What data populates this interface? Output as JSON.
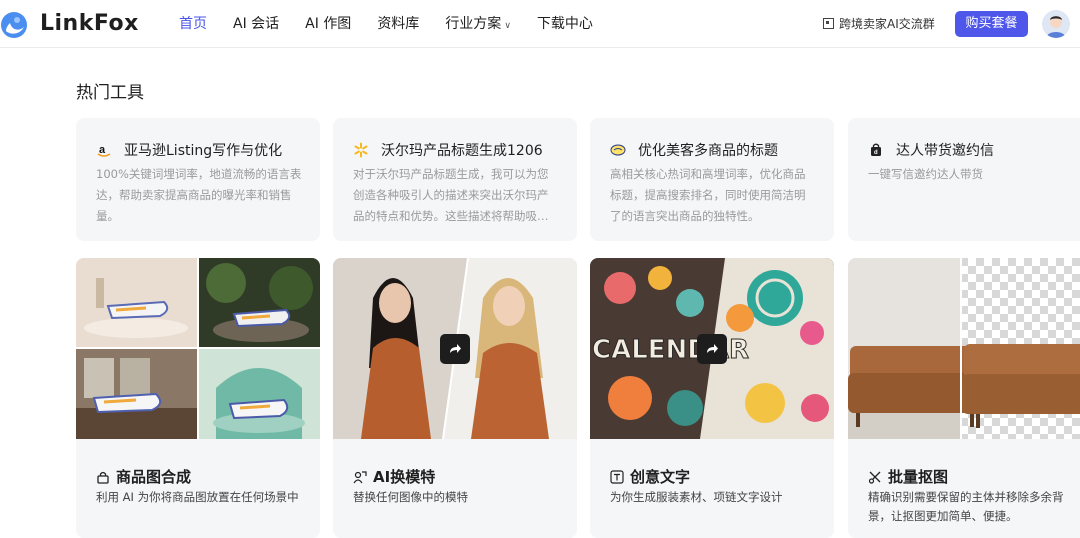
{
  "brand": {
    "name": "LinkFox",
    "colors": {
      "accent": "#4a55e8",
      "button": "#4e57ea",
      "card_bg": "#f5f6f8"
    }
  },
  "nav": {
    "items": [
      {
        "label": "首页",
        "active": true
      },
      {
        "label": "AI 会话"
      },
      {
        "label": "AI 作图"
      },
      {
        "label": "资料库"
      },
      {
        "label": "行业方案",
        "has_dropdown": true
      },
      {
        "label": "下载中心"
      }
    ]
  },
  "header": {
    "community_label": "跨境卖家AI交流群",
    "buy_label": "购买套餐",
    "avatar_icon": "user-avatar"
  },
  "section": {
    "title": "热门工具"
  },
  "tools": [
    {
      "icon": "amazon-icon",
      "name": "亚马逊Listing写作与优化",
      "desc": "100%关键词埋词率，地道流畅的语言表达，帮助卖家提高商品的曝光率和销售量。"
    },
    {
      "icon": "walmart-icon",
      "name": "沃尔玛产品标题生成1206",
      "desc": "对于沃尔玛产品标题生成，我可以为您创造各种吸引人的描述来突出沃尔玛产品的特点和优势。这些描述将帮助吸引更多顾客。"
    },
    {
      "icon": "meike-icon",
      "name": "优化美客多商品的标题",
      "desc": "高相关核心热词和高埋词率，优化商品标题，提高搜索排名，同时使用简洁明了的语言突出商品的独特性。"
    },
    {
      "icon": "bag-icon",
      "name": "达人带货邀约信",
      "desc": "一键写信邀约达人带货"
    }
  ],
  "features": [
    {
      "icon": "lock-icon",
      "title": "商品图合成",
      "desc": "利用 AI 为你将商品图放置在任何场景中"
    },
    {
      "icon": "model-swap-icon",
      "title": "AI换模特",
      "desc": "替换任何图像中的模特"
    },
    {
      "icon": "text-icon",
      "title": "创意文字",
      "desc": "为你生成服装素材、项链文字设计"
    },
    {
      "icon": "cutout-icon",
      "title": "批量抠图",
      "desc": "精确识别需要保留的主体并移除多余背景，让抠图更加简单、便捷。"
    }
  ],
  "creative_text_sample": "CALENDAR"
}
